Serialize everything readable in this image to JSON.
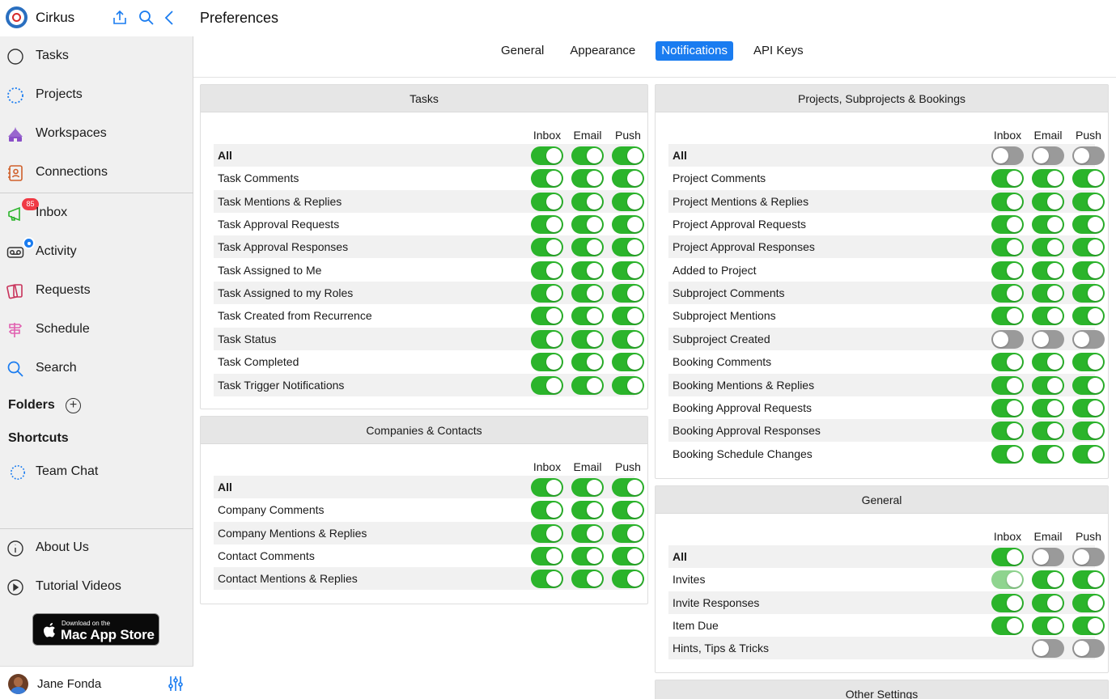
{
  "app": {
    "name": "Cirkus"
  },
  "sidebar": {
    "nav": [
      {
        "label": "Tasks"
      },
      {
        "label": "Projects"
      },
      {
        "label": "Workspaces"
      },
      {
        "label": "Connections"
      },
      {
        "label": "Inbox",
        "badge": "85"
      },
      {
        "label": "Activity"
      },
      {
        "label": "Requests"
      },
      {
        "label": "Schedule"
      },
      {
        "label": "Search"
      }
    ],
    "folders_label": "Folders",
    "shortcuts_label": "Shortcuts",
    "shortcuts": [
      {
        "label": "Team Chat"
      }
    ],
    "footer_nav": [
      {
        "label": "About Us"
      },
      {
        "label": "Tutorial Videos"
      }
    ],
    "appstore": {
      "small": "Download on the",
      "big": "Mac App Store"
    },
    "user": {
      "name": "Jane Fonda"
    }
  },
  "main": {
    "title": "Preferences",
    "tabs": [
      {
        "label": "General"
      },
      {
        "label": "Appearance"
      },
      {
        "label": "Notifications",
        "active": true
      },
      {
        "label": "API Keys"
      }
    ],
    "columns": [
      "Inbox",
      "Email",
      "Push"
    ],
    "panels": {
      "tasks": {
        "title": "Tasks",
        "rows": [
          {
            "label": "All",
            "bold": true,
            "toggles": [
              "on",
              "on",
              "on"
            ]
          },
          {
            "label": "Task Comments",
            "toggles": [
              "on",
              "on",
              "on"
            ]
          },
          {
            "label": "Task Mentions & Replies",
            "toggles": [
              "on",
              "on",
              "on"
            ]
          },
          {
            "label": "Task Approval Requests",
            "toggles": [
              "on",
              "on",
              "on"
            ]
          },
          {
            "label": "Task Approval Responses",
            "toggles": [
              "on",
              "on",
              "on"
            ]
          },
          {
            "label": "Task Assigned to Me",
            "toggles": [
              "on",
              "on",
              "on"
            ]
          },
          {
            "label": "Task Assigned to my Roles",
            "toggles": [
              "on",
              "on",
              "on"
            ]
          },
          {
            "label": "Task Created from Recurrence",
            "toggles": [
              "on",
              "on",
              "on"
            ]
          },
          {
            "label": "Task Status",
            "toggles": [
              "on",
              "on",
              "on"
            ]
          },
          {
            "label": "Task Completed",
            "toggles": [
              "on",
              "on",
              "on"
            ]
          },
          {
            "label": "Task Trigger Notifications",
            "toggles": [
              "on",
              "on",
              "on"
            ]
          }
        ]
      },
      "companies": {
        "title": "Companies & Contacts",
        "rows": [
          {
            "label": "All",
            "bold": true,
            "toggles": [
              "on",
              "on",
              "on"
            ]
          },
          {
            "label": "Company Comments",
            "toggles": [
              "on",
              "on",
              "on"
            ]
          },
          {
            "label": "Company Mentions & Replies",
            "toggles": [
              "on",
              "on",
              "on"
            ]
          },
          {
            "label": "Contact Comments",
            "toggles": [
              "on",
              "on",
              "on"
            ]
          },
          {
            "label": "Contact Mentions & Replies",
            "toggles": [
              "on",
              "on",
              "on"
            ]
          }
        ]
      },
      "projects": {
        "title": "Projects, Subprojects & Bookings",
        "rows": [
          {
            "label": "All",
            "bold": true,
            "toggles": [
              "off",
              "off",
              "off"
            ]
          },
          {
            "label": "Project Comments",
            "toggles": [
              "on",
              "on",
              "on"
            ]
          },
          {
            "label": "Project Mentions & Replies",
            "toggles": [
              "on",
              "on",
              "on"
            ]
          },
          {
            "label": "Project Approval Requests",
            "toggles": [
              "on",
              "on",
              "on"
            ]
          },
          {
            "label": "Project Approval Responses",
            "toggles": [
              "on",
              "on",
              "on"
            ]
          },
          {
            "label": "Added to Project",
            "toggles": [
              "on",
              "on",
              "on"
            ]
          },
          {
            "label": "Subproject Comments",
            "toggles": [
              "on",
              "on",
              "on"
            ]
          },
          {
            "label": "Subproject Mentions",
            "toggles": [
              "on",
              "on",
              "on"
            ]
          },
          {
            "label": "Subproject Created",
            "toggles": [
              "off",
              "off",
              "off"
            ]
          },
          {
            "label": "Booking Comments",
            "toggles": [
              "on",
              "on",
              "on"
            ]
          },
          {
            "label": "Booking Mentions & Replies",
            "toggles": [
              "on",
              "on",
              "on"
            ]
          },
          {
            "label": "Booking Approval Requests",
            "toggles": [
              "on",
              "on",
              "on"
            ]
          },
          {
            "label": "Booking Approval Responses",
            "toggles": [
              "on",
              "on",
              "on"
            ]
          },
          {
            "label": "Booking Schedule Changes",
            "toggles": [
              "on",
              "on",
              "on"
            ]
          }
        ]
      },
      "general": {
        "title": "General",
        "rows": [
          {
            "label": "All",
            "bold": true,
            "toggles": [
              "on",
              "off",
              "off"
            ]
          },
          {
            "label": "Invites",
            "toggles": [
              "disabled-on",
              "on",
              "on"
            ]
          },
          {
            "label": "Invite Responses",
            "toggles": [
              "on",
              "on",
              "on"
            ]
          },
          {
            "label": "Item Due",
            "toggles": [
              "on",
              "on",
              "on"
            ]
          },
          {
            "label": "Hints, Tips & Tricks",
            "toggles": [
              "none",
              "off",
              "off"
            ]
          }
        ]
      },
      "other": {
        "title": "Other Settings"
      }
    }
  },
  "colors": {
    "accent": "#1a7cf0",
    "toggle_on": "#2bb42b",
    "toggle_off": "#9a9a9a",
    "badge": "#f03a45"
  }
}
